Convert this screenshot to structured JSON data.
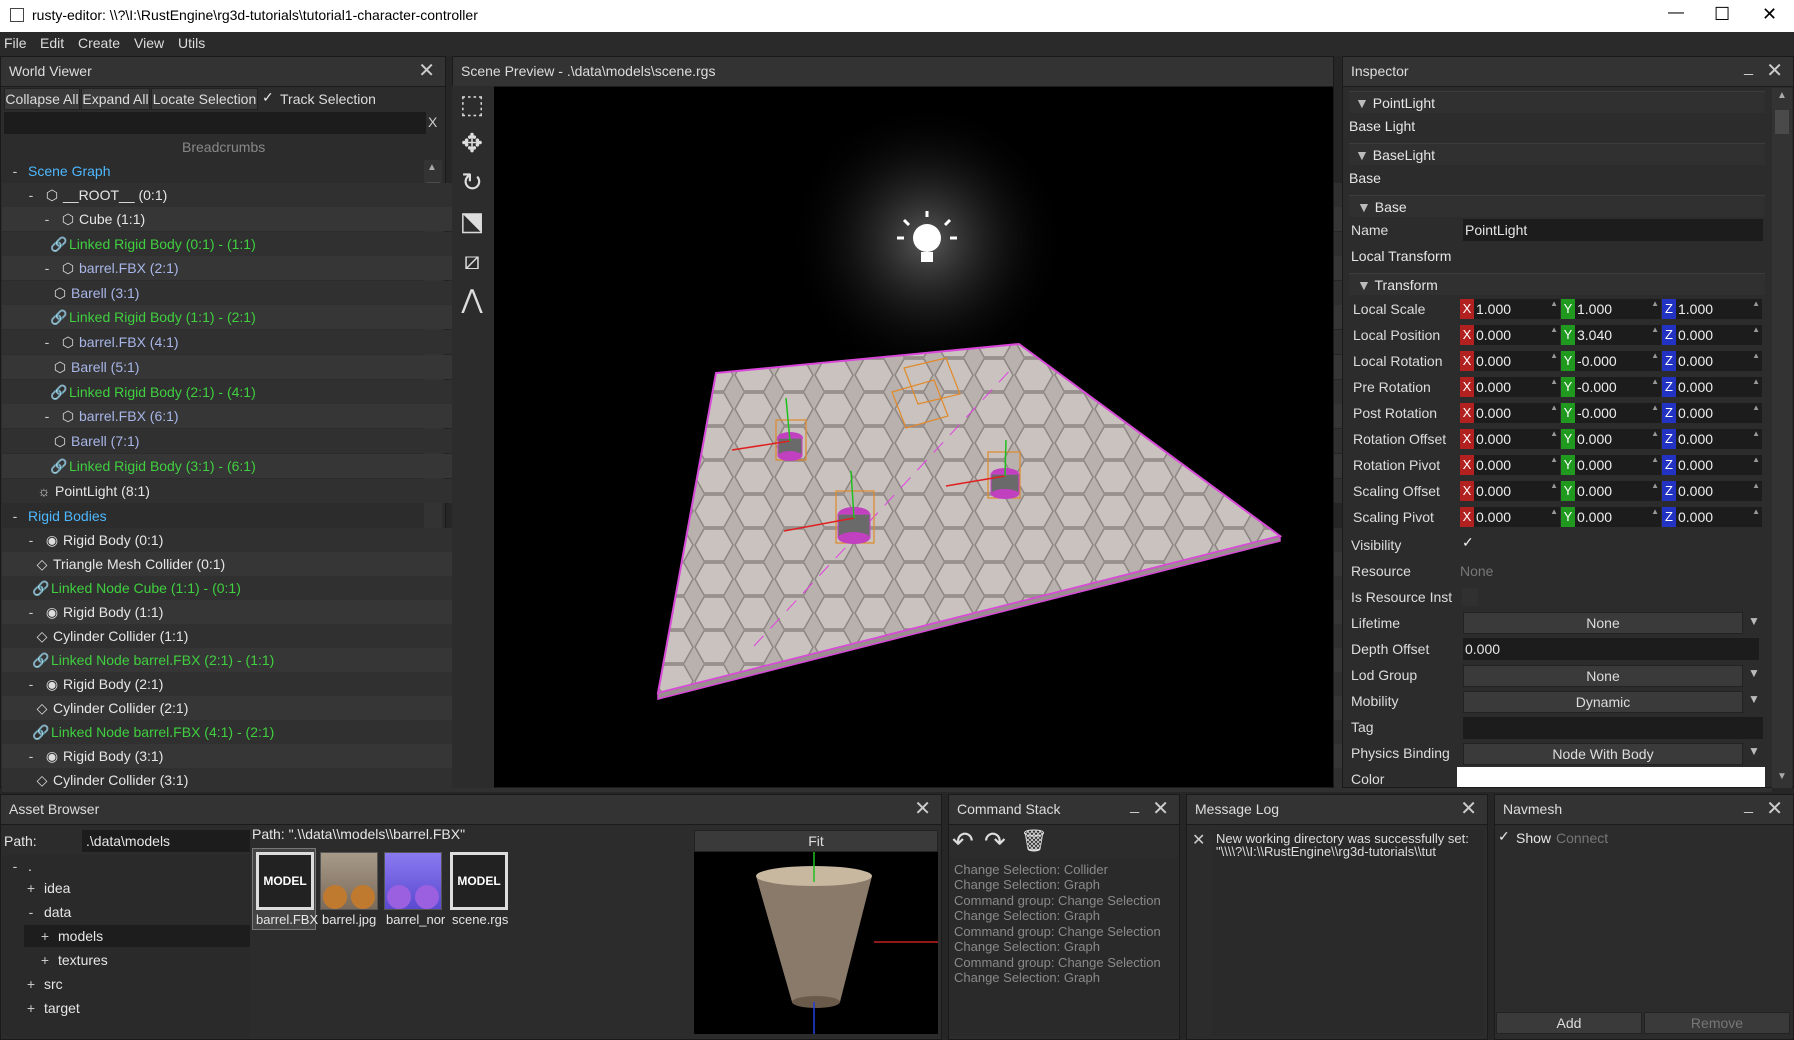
{
  "window": {
    "title": "rusty-editor: \\\\?\\I:\\RustEngine\\rg3d-tutorials\\tutorial1-character-controller",
    "minimize": "—",
    "maximize": "☐",
    "close": "✕"
  },
  "menu": {
    "items": [
      "File",
      "Edit",
      "Create",
      "View",
      "Utils"
    ]
  },
  "world_viewer": {
    "title": "World Viewer",
    "buttons": [
      "Collapse All",
      "Expand All",
      "Locate Selection"
    ],
    "track_selection": "Track Selection",
    "search_clear": "X",
    "breadcrumbs": "Breadcrumbs",
    "scene_graph": "Scene Graph",
    "rigid_bodies": "Rigid Bodies",
    "nodes": [
      "__ROOT__ (0:1)",
      "Cube (1:1)",
      "Linked Rigid Body (0:1) - (1:1)",
      "barrel.FBX (2:1)",
      "Barell (3:1)",
      "Linked Rigid Body (1:1) - (2:1)",
      "barrel.FBX (4:1)",
      "Barell (5:1)",
      "Linked Rigid Body (2:1) - (4:1)",
      "barrel.FBX (6:1)",
      "Barell (7:1)",
      "Linked Rigid Body (3:1) - (6:1)",
      "PointLight (8:1)"
    ],
    "bodies": [
      "Rigid Body (0:1)",
      "Triangle Mesh Collider (0:1)",
      "Linked Node Cube (1:1) - (0:1)",
      "Rigid Body (1:1)",
      "Cylinder Collider (1:1)",
      "Linked Node barrel.FBX (2:1) - (1:1)",
      "Rigid Body (2:1)",
      "Cylinder Collider (2:1)",
      "Linked Node barrel.FBX (4:1) - (2:1)",
      "Rigid Body (3:1)",
      "Cylinder Collider (3:1)"
    ],
    "collapse": "-"
  },
  "scene_preview": {
    "title": "Scene Preview - .\\data\\models\\scene.rgs"
  },
  "inspector": {
    "title": "Inspector",
    "sections": {
      "point_light": "PointLight",
      "base_light_label": "Base Light",
      "base_light": "BaseLight",
      "base_label": "Base",
      "base": "Base",
      "transform": "Transform"
    },
    "name_label": "Name",
    "name_value": "PointLight",
    "local_transform": "Local Transform",
    "transform_rows": [
      {
        "label": "Local Scale",
        "x": "1.000",
        "y": "1.000",
        "z": "1.000"
      },
      {
        "label": "Local Position",
        "x": "0.000",
        "y": "3.040",
        "z": "0.000"
      },
      {
        "label": "Local Rotation",
        "x": "0.000",
        "y": "-0.000",
        "z": "0.000"
      },
      {
        "label": "Pre Rotation",
        "x": "0.000",
        "y": "-0.000",
        "z": "0.000"
      },
      {
        "label": "Post Rotation",
        "x": "0.000",
        "y": "-0.000",
        "z": "0.000"
      },
      {
        "label": "Rotation Offset",
        "x": "0.000",
        "y": "0.000",
        "z": "0.000"
      },
      {
        "label": "Rotation Pivot",
        "x": "0.000",
        "y": "0.000",
        "z": "0.000"
      },
      {
        "label": "Scaling Offset",
        "x": "0.000",
        "y": "0.000",
        "z": "0.000"
      },
      {
        "label": "Scaling Pivot",
        "x": "0.000",
        "y": "0.000",
        "z": "0.000"
      }
    ],
    "axes": {
      "x": "X",
      "y": "Y",
      "z": "Z"
    },
    "visibility": "Visibility",
    "resource": "Resource",
    "resource_value": "None",
    "is_resource_inst": "Is Resource Inst",
    "lifetime": "Lifetime",
    "lifetime_value": "None",
    "depth_offset": "Depth Offset",
    "depth_offset_value": "0.000",
    "lod_group": "Lod Group",
    "lod_group_value": "None",
    "mobility": "Mobility",
    "mobility_value": "Dynamic",
    "tag": "Tag",
    "physics_binding": "Physics Binding",
    "physics_binding_value": "Node With Body",
    "color": "Color"
  },
  "asset_browser": {
    "title": "Asset Browser",
    "path_label": "Path:",
    "path_value": ".\\data\\models",
    "root": ".",
    "folders": [
      "idea",
      "data",
      "models",
      "textures",
      "src",
      "target"
    ],
    "expanders": {
      "plus": "+",
      "minus": "-"
    },
    "selected_path": "Path: \".\\\\data\\\\models\\\\barrel.FBX\"",
    "assets": [
      "barrel.FBX",
      "barrel.jpg",
      "barrel_nor",
      "scene.rgs"
    ],
    "model_badge": "MODEL",
    "fit": "Fit"
  },
  "command_stack": {
    "title": "Command Stack",
    "entries": [
      "Change Selection: Collider",
      "Change Selection: Graph",
      "Command group: Change Selection",
      "Change Selection: Graph",
      "Command group: Change Selection",
      "Change Selection: Graph",
      "Command group: Change Selection",
      "Change Selection: Graph"
    ]
  },
  "message_log": {
    "title": "Message Log",
    "message": "New working directory was successfully set: \"\\\\\\\\?\\\\I:\\\\RustEngine\\\\rg3d-tutorials\\\\tut"
  },
  "navmesh": {
    "title": "Navmesh",
    "show": "Show",
    "connect": "Connect",
    "add": "Add",
    "remove": "Remove"
  },
  "colors": {
    "accent_green": "#3fcf3f",
    "accent_blue": "#4db8ff",
    "gizmo_magenta": "#e040e0"
  }
}
